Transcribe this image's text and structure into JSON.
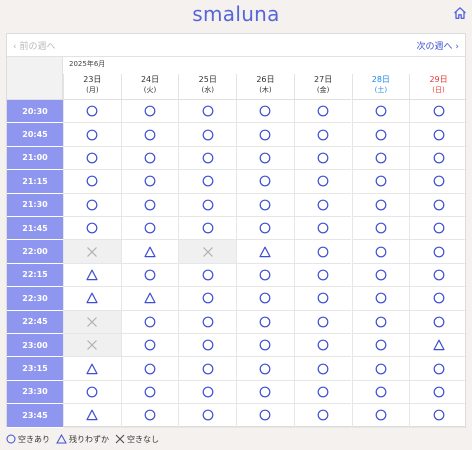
{
  "app": {
    "logo": "smaluna"
  },
  "nav": {
    "prev_week": "前の週へ",
    "next_week": "次の週へ"
  },
  "calendar": {
    "month_label": "2025年6月",
    "days": [
      {
        "date": "23日",
        "dow": "(月)",
        "color": "#333333"
      },
      {
        "date": "24日",
        "dow": "(火)",
        "color": "#333333"
      },
      {
        "date": "25日",
        "dow": "(水)",
        "color": "#333333"
      },
      {
        "date": "26日",
        "dow": "(木)",
        "color": "#333333"
      },
      {
        "date": "27日",
        "dow": "(金)",
        "color": "#333333"
      },
      {
        "date": "28日",
        "dow": "(土)",
        "color": "#1e88e5"
      },
      {
        "date": "29日",
        "dow": "(日)",
        "color": "#e53935"
      }
    ],
    "rows": [
      {
        "time": "20:30",
        "slots": [
          "available",
          "available",
          "available",
          "available",
          "available",
          "available",
          "available"
        ]
      },
      {
        "time": "20:45",
        "slots": [
          "available",
          "available",
          "available",
          "available",
          "available",
          "available",
          "available"
        ]
      },
      {
        "time": "21:00",
        "slots": [
          "available",
          "available",
          "available",
          "available",
          "available",
          "available",
          "available"
        ]
      },
      {
        "time": "21:15",
        "slots": [
          "available",
          "available",
          "available",
          "available",
          "available",
          "available",
          "available"
        ]
      },
      {
        "time": "21:30",
        "slots": [
          "available",
          "available",
          "available",
          "available",
          "available",
          "available",
          "available"
        ]
      },
      {
        "time": "21:45",
        "slots": [
          "available",
          "available",
          "available",
          "available",
          "available",
          "available",
          "available"
        ]
      },
      {
        "time": "22:00",
        "slots": [
          "full",
          "few",
          "full",
          "few",
          "available",
          "available",
          "available"
        ]
      },
      {
        "time": "22:15",
        "slots": [
          "few",
          "available",
          "available",
          "available",
          "available",
          "available",
          "available"
        ]
      },
      {
        "time": "22:30",
        "slots": [
          "few",
          "few",
          "available",
          "available",
          "available",
          "available",
          "available"
        ]
      },
      {
        "time": "22:45",
        "slots": [
          "full",
          "available",
          "available",
          "available",
          "available",
          "available",
          "available"
        ]
      },
      {
        "time": "23:00",
        "slots": [
          "full",
          "available",
          "available",
          "available",
          "available",
          "available",
          "few"
        ]
      },
      {
        "time": "23:15",
        "slots": [
          "few",
          "available",
          "available",
          "available",
          "available",
          "available",
          "available"
        ]
      },
      {
        "time": "23:30",
        "slots": [
          "available",
          "available",
          "available",
          "available",
          "available",
          "available",
          "available"
        ]
      },
      {
        "time": "23:45",
        "slots": [
          "few",
          "available",
          "available",
          "available",
          "available",
          "available",
          "available"
        ]
      }
    ]
  },
  "legend": {
    "available": "空きあり",
    "few": "残りわずか",
    "full": "空きなし"
  },
  "colors": {
    "accent": "#5566d9",
    "time_bg": "#8e96f0",
    "symbol": "#3d4fd1",
    "full_mark": "#b0b0b0"
  }
}
